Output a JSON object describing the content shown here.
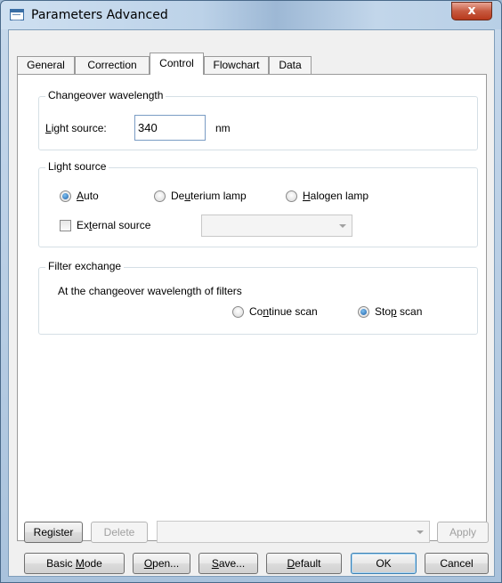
{
  "window": {
    "title": "Parameters  Advanced",
    "close_glyph": "x"
  },
  "tabs": [
    "General",
    "Correction",
    "Control",
    "Flowchart",
    "Data"
  ],
  "changeover": {
    "group_label": "Changeover wavelength",
    "light_source_label_pre": "",
    "light_source_label_u": "L",
    "light_source_label_post": "ight source:",
    "value": "340",
    "unit": "nm"
  },
  "light_source": {
    "group_label": "Light source",
    "auto_u": "A",
    "auto_post": "uto",
    "deuterium_pre": "De",
    "deuterium_u": "u",
    "deuterium_post": "terium lamp",
    "halogen_u": "H",
    "halogen_post": "alogen lamp",
    "selected": "Auto",
    "external_pre": "Ex",
    "external_u": "t",
    "external_post": "ernal source",
    "external_checked": false
  },
  "filter_exchange": {
    "group_label": "Filter exchange",
    "description": "At the changeover wavelength of filters",
    "continue_pre": "Co",
    "continue_u": "n",
    "continue_post": "tinue scan",
    "stop_pre": "Sto",
    "stop_u": "p",
    "stop_post": " scan",
    "selected": "Stop scan"
  },
  "bottom_row1": {
    "register": "Register",
    "delete": "Delete",
    "apply": "Apply"
  },
  "bottom_row2": {
    "basic_mode_pre": "Basic ",
    "basic_mode_u": "M",
    "basic_mode_post": "ode",
    "open_u": "O",
    "open_post": "pen...",
    "save_u": "S",
    "save_post": "ave...",
    "default_u": "D",
    "default_post": "efault",
    "ok": "OK",
    "cancel": "Cancel"
  },
  "colors": {
    "titlebar": "#bcd2e8",
    "close_button": "#c75a40",
    "radio_selected": "#1c5fa8",
    "dialog_bg": "#f0f0f0"
  }
}
